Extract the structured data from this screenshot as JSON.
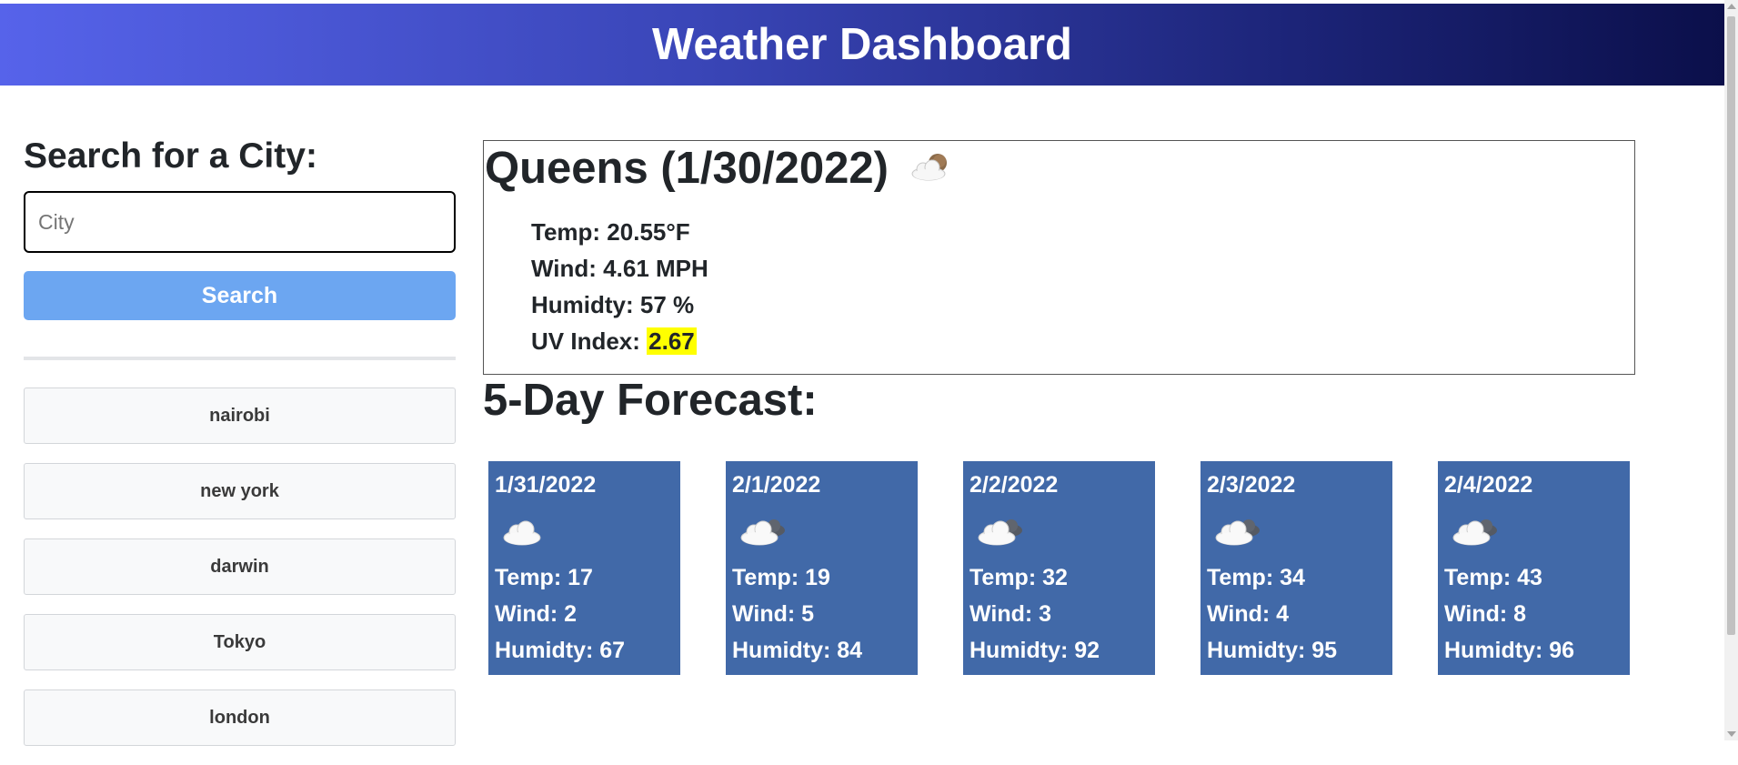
{
  "header": {
    "title": "Weather Dashboard"
  },
  "sidebar": {
    "heading": "Search for a City:",
    "search_placeholder": "City",
    "search_value": "",
    "search_button": "Search",
    "history": [
      "nairobi",
      "new york",
      "darwin",
      "Tokyo",
      "london"
    ]
  },
  "current": {
    "title": "Queens (1/30/2022)",
    "icon": "partly-cloudy-night-icon",
    "temp_label": "Temp: 20.55°F",
    "wind_label": "Wind: 4.61 MPH",
    "humidity_label": "Humidty: 57 %",
    "uv_label": "UV Index:",
    "uv_value": "2.67",
    "uv_color": "#ffff00"
  },
  "forecast": {
    "heading": "5-Day Forecast:",
    "card_color": "#4169a8",
    "days": [
      {
        "date": "1/31/2022",
        "icon": "cloud-icon",
        "temp": "Temp: 17",
        "wind": "Wind: 2",
        "humidity": "Humidty: 67"
      },
      {
        "date": "2/1/2022",
        "icon": "overcast-cloud-icon",
        "temp": "Temp: 19",
        "wind": "Wind: 5",
        "humidity": "Humidty: 84"
      },
      {
        "date": "2/2/2022",
        "icon": "overcast-cloud-icon",
        "temp": "Temp: 32",
        "wind": "Wind: 3",
        "humidity": "Humidty: 92"
      },
      {
        "date": "2/3/2022",
        "icon": "overcast-cloud-icon",
        "temp": "Temp: 34",
        "wind": "Wind: 4",
        "humidity": "Humidty: 95"
      },
      {
        "date": "2/4/2022",
        "icon": "overcast-cloud-icon",
        "temp": "Temp: 43",
        "wind": "Wind: 8",
        "humidity": "Humidty: 96"
      }
    ]
  }
}
